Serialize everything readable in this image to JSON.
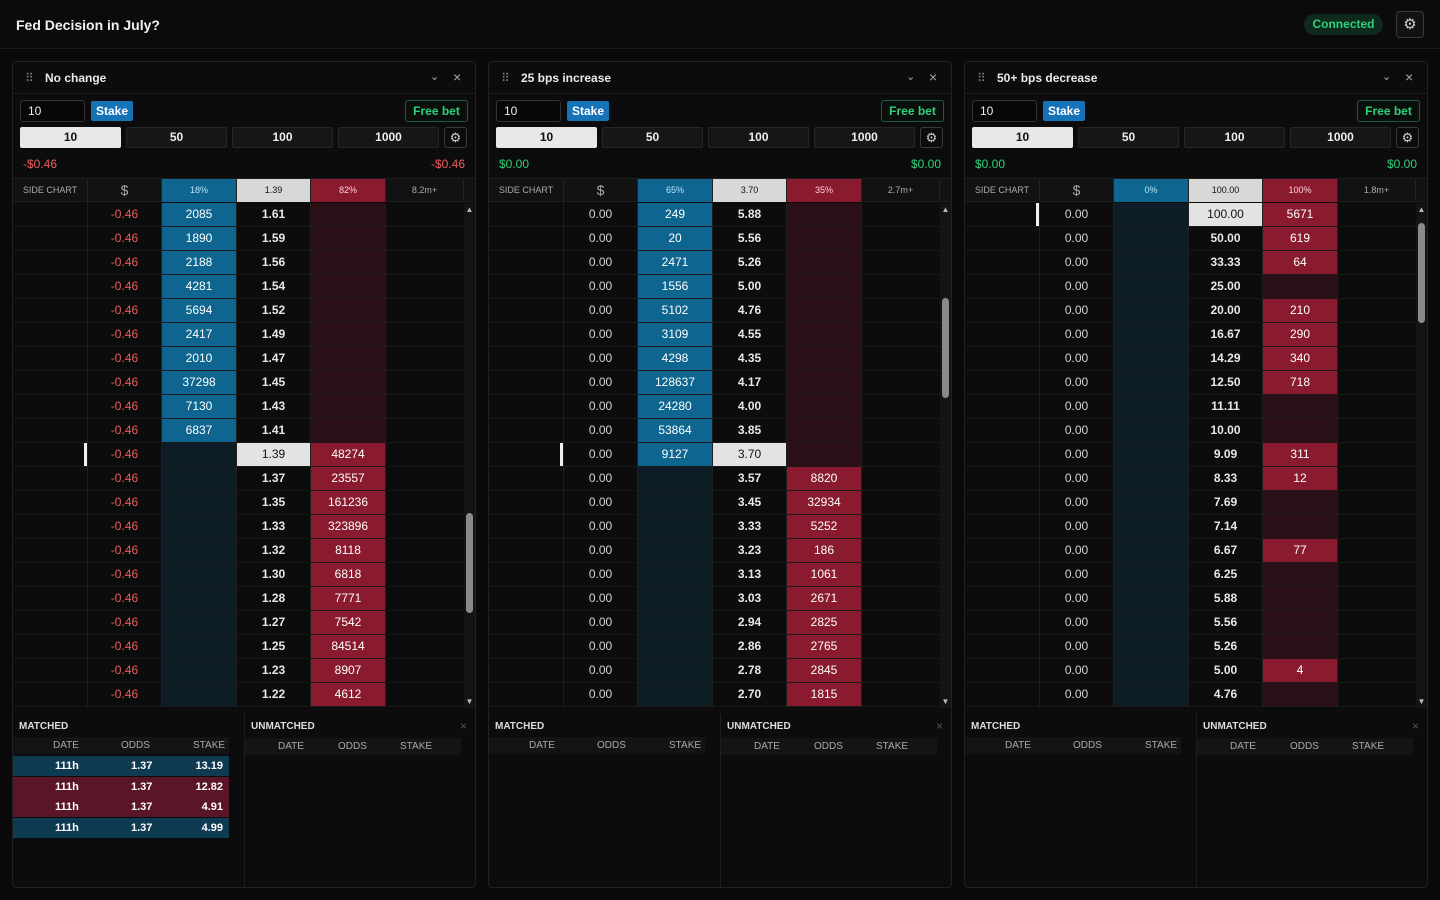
{
  "header": {
    "title": "Fed Decision in July?",
    "status": "Connected",
    "settings_icon": "gear-icon"
  },
  "colors": {
    "back": "#0e6690",
    "back_dim": "#0c1d26",
    "lay": "#8a1a2e",
    "lay_dim": "#2a0f16",
    "ltp": "#e3e3e3",
    "positive": "#2fd07a",
    "negative": "#f15b5b"
  },
  "common": {
    "stake_btn": "Stake",
    "free_bet": "Free bet",
    "quick": [
      "10",
      "50",
      "100",
      "1000"
    ],
    "side_chart": "SIDE CHART",
    "dollar": "$",
    "matched": "MATCHED",
    "unmatched": "UNMATCHED",
    "cols": [
      "DATE",
      "ODDS",
      "STAKE"
    ],
    "grip_icon": "⠿",
    "chevron": "⌄",
    "close": "×",
    "gear": "⚙"
  },
  "panels": [
    {
      "title": "No change",
      "stake_value": "10",
      "pl_left": "-$0.46",
      "pl_right": "-$0.46",
      "pl_sign": "neg",
      "back_pct": "18%",
      "ltp_price": "1.39",
      "lay_pct": "82%",
      "volume": "8.2m+",
      "ltp_row": 10,
      "rows": [
        [
          "-0.46",
          "2085",
          "1.61",
          ""
        ],
        [
          "-0.46",
          "1890",
          "1.59",
          ""
        ],
        [
          "-0.46",
          "2188",
          "1.56",
          ""
        ],
        [
          "-0.46",
          "4281",
          "1.54",
          ""
        ],
        [
          "-0.46",
          "5694",
          "1.52",
          ""
        ],
        [
          "-0.46",
          "2417",
          "1.49",
          ""
        ],
        [
          "-0.46",
          "2010",
          "1.47",
          ""
        ],
        [
          "-0.46",
          "37298",
          "1.45",
          ""
        ],
        [
          "-0.46",
          "7130",
          "1.43",
          ""
        ],
        [
          "-0.46",
          "6837",
          "1.41",
          ""
        ],
        [
          "-0.46",
          "",
          "1.39",
          "48274"
        ],
        [
          "-0.46",
          "",
          "1.37",
          "23557"
        ],
        [
          "-0.46",
          "",
          "1.35",
          "161236"
        ],
        [
          "-0.46",
          "",
          "1.33",
          "323896"
        ],
        [
          "-0.46",
          "",
          "1.32",
          "8118"
        ],
        [
          "-0.46",
          "",
          "1.30",
          "6818"
        ],
        [
          "-0.46",
          "",
          "1.28",
          "7771"
        ],
        [
          "-0.46",
          "",
          "1.27",
          "7542"
        ],
        [
          "-0.46",
          "",
          "1.25",
          "84514"
        ],
        [
          "-0.46",
          "",
          "1.23",
          "8907"
        ],
        [
          "-0.46",
          "",
          "1.22",
          "4612"
        ]
      ],
      "matched_rows": [
        {
          "date": "111h",
          "odds": "1.37",
          "stake": "13.19",
          "side": "back"
        },
        {
          "date": "111h",
          "odds": "1.37",
          "stake": "12.82",
          "side": "lay"
        },
        {
          "date": "111h",
          "odds": "1.37",
          "stake": "4.91",
          "side": "lay"
        },
        {
          "date": "111h",
          "odds": "1.37",
          "stake": "4.99",
          "side": "back"
        }
      ]
    },
    {
      "title": "25 bps increase",
      "stake_value": "10",
      "pl_left": "$0.00",
      "pl_right": "$0.00",
      "pl_sign": "pos",
      "back_pct": "65%",
      "ltp_price": "3.70",
      "lay_pct": "35%",
      "volume": "2.7m+",
      "ltp_row": 10,
      "rows": [
        [
          "0.00",
          "249",
          "5.88",
          ""
        ],
        [
          "0.00",
          "20",
          "5.56",
          ""
        ],
        [
          "0.00",
          "2471",
          "5.26",
          ""
        ],
        [
          "0.00",
          "1556",
          "5.00",
          ""
        ],
        [
          "0.00",
          "5102",
          "4.76",
          ""
        ],
        [
          "0.00",
          "3109",
          "4.55",
          ""
        ],
        [
          "0.00",
          "4298",
          "4.35",
          ""
        ],
        [
          "0.00",
          "128637",
          "4.17",
          ""
        ],
        [
          "0.00",
          "24280",
          "4.00",
          ""
        ],
        [
          "0.00",
          "53864",
          "3.85",
          ""
        ],
        [
          "0.00",
          "9127",
          "3.70",
          ""
        ],
        [
          "0.00",
          "",
          "3.57",
          "8820"
        ],
        [
          "0.00",
          "",
          "3.45",
          "32934"
        ],
        [
          "0.00",
          "",
          "3.33",
          "5252"
        ],
        [
          "0.00",
          "",
          "3.23",
          "186"
        ],
        [
          "0.00",
          "",
          "3.13",
          "1061"
        ],
        [
          "0.00",
          "",
          "3.03",
          "2671"
        ],
        [
          "0.00",
          "",
          "2.94",
          "2825"
        ],
        [
          "0.00",
          "",
          "2.86",
          "2765"
        ],
        [
          "0.00",
          "",
          "2.78",
          "2845"
        ],
        [
          "0.00",
          "",
          "2.70",
          "1815"
        ]
      ],
      "matched_rows": []
    },
    {
      "title": "50+ bps decrease",
      "stake_value": "10",
      "pl_left": "$0.00",
      "pl_right": "$0.00",
      "pl_sign": "pos",
      "back_pct": "0%",
      "ltp_price": "100.00",
      "lay_pct": "100%",
      "volume": "1.8m+",
      "ltp_row": 0,
      "rows": [
        [
          "0.00",
          "",
          "100.00",
          "5671"
        ],
        [
          "0.00",
          "",
          "50.00",
          "619"
        ],
        [
          "0.00",
          "",
          "33.33",
          "64"
        ],
        [
          "0.00",
          "",
          "25.00",
          ""
        ],
        [
          "0.00",
          "",
          "20.00",
          "210"
        ],
        [
          "0.00",
          "",
          "16.67",
          "290"
        ],
        [
          "0.00",
          "",
          "14.29",
          "340"
        ],
        [
          "0.00",
          "",
          "12.50",
          "718"
        ],
        [
          "0.00",
          "",
          "11.11",
          ""
        ],
        [
          "0.00",
          "",
          "10.00",
          ""
        ],
        [
          "0.00",
          "",
          "9.09",
          "311"
        ],
        [
          "0.00",
          "",
          "8.33",
          "12"
        ],
        [
          "0.00",
          "",
          "7.69",
          ""
        ],
        [
          "0.00",
          "",
          "7.14",
          ""
        ],
        [
          "0.00",
          "",
          "6.67",
          "77"
        ],
        [
          "0.00",
          "",
          "6.25",
          ""
        ],
        [
          "0.00",
          "",
          "5.88",
          ""
        ],
        [
          "0.00",
          "",
          "5.56",
          ""
        ],
        [
          "0.00",
          "",
          "5.26",
          ""
        ],
        [
          "0.00",
          "",
          "5.00",
          "4"
        ],
        [
          "0.00",
          "",
          "4.76",
          ""
        ]
      ],
      "matched_rows": []
    }
  ]
}
